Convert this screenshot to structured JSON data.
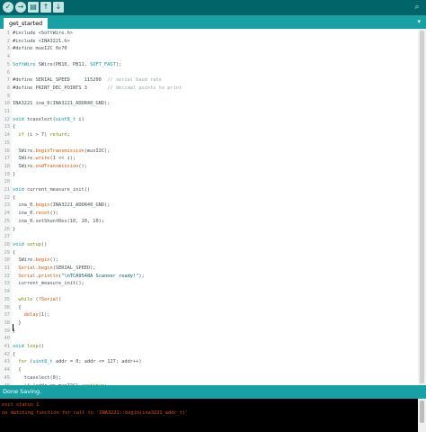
{
  "toolbar": {
    "verify_icon": "✓",
    "upload_icon": "→",
    "new_icon": "▤",
    "open_icon": "↑",
    "save_icon": "↓",
    "serial_monitor_icon": "⌕"
  },
  "tabs": [
    {
      "label": "get_started"
    }
  ],
  "tab_menu_icon": "▾",
  "editor": {
    "lines": [
      {
        "n": "1",
        "tokens": [
          {
            "t": "#include <SoftWire.h>"
          }
        ]
      },
      {
        "n": "2",
        "tokens": [
          {
            "t": "#include <INA3221.h>"
          }
        ]
      },
      {
        "n": "3",
        "tokens": [
          {
            "t": "#define muxI2C 0x70"
          }
        ]
      },
      {
        "n": "4",
        "tokens": []
      },
      {
        "n": "5",
        "tokens": [
          {
            "t": "SoftWire",
            "c": "ty"
          },
          {
            "t": " SWire(PB10, PB11, "
          },
          {
            "t": "SOFT_FAST",
            "c": "ty"
          },
          {
            "t": ");"
          }
        ]
      },
      {
        "n": "6",
        "tokens": []
      },
      {
        "n": "7",
        "tokens": [
          {
            "t": "#define SERIAL_SPEED     115200  "
          },
          {
            "t": "// serial baud rate",
            "c": "cm"
          }
        ]
      },
      {
        "n": "8",
        "tokens": [
          {
            "t": "#define PRINT_DEC_POINTS 3       "
          },
          {
            "t": "// decimal points to print",
            "c": "cm"
          }
        ]
      },
      {
        "n": "9",
        "tokens": []
      },
      {
        "n": "10",
        "tokens": [
          {
            "t": "INA3221 ina_0(INA3221_ADDR40_GND);"
          }
        ]
      },
      {
        "n": "11",
        "tokens": []
      },
      {
        "n": "12",
        "tokens": [
          {
            "t": "void",
            "c": "ty"
          },
          {
            "t": " tcaselect("
          },
          {
            "t": "uint8_t",
            "c": "ty"
          },
          {
            "t": " i)"
          }
        ]
      },
      {
        "n": "13",
        "tokens": [
          {
            "t": "{"
          }
        ]
      },
      {
        "n": "14",
        "tokens": [
          {
            "t": "  "
          },
          {
            "t": "if",
            "c": "kw"
          },
          {
            "t": " (i > 7) "
          },
          {
            "t": "return",
            "c": "kw"
          },
          {
            "t": ";"
          }
        ]
      },
      {
        "n": "15",
        "tokens": []
      },
      {
        "n": "16",
        "tokens": [
          {
            "t": "  SWire."
          },
          {
            "t": "beginTransmission",
            "c": "fn"
          },
          {
            "t": "(muxI2C);"
          }
        ]
      },
      {
        "n": "17",
        "tokens": [
          {
            "t": "  SWire."
          },
          {
            "t": "write",
            "c": "fn"
          },
          {
            "t": "(1 << i);"
          }
        ]
      },
      {
        "n": "18",
        "tokens": [
          {
            "t": "  SWire."
          },
          {
            "t": "endTransmission",
            "c": "fn"
          },
          {
            "t": "();"
          }
        ]
      },
      {
        "n": "19",
        "tokens": [
          {
            "t": "}"
          }
        ]
      },
      {
        "n": "20",
        "tokens": []
      },
      {
        "n": "21",
        "tokens": [
          {
            "t": "void",
            "c": "ty"
          },
          {
            "t": " current_measure_init()"
          }
        ]
      },
      {
        "n": "22",
        "tokens": [
          {
            "t": "{"
          }
        ]
      },
      {
        "n": "23",
        "tokens": [
          {
            "t": "  ina_0."
          },
          {
            "t": "begin",
            "c": "fn"
          },
          {
            "t": "(INA3221_ADDR40_GND);"
          }
        ]
      },
      {
        "n": "24",
        "tokens": [
          {
            "t": "  ina_0."
          },
          {
            "t": "reset",
            "c": "fn"
          },
          {
            "t": "();"
          }
        ]
      },
      {
        "n": "25",
        "tokens": [
          {
            "t": "  ina_0.setShuntRes(10, 10, 10);"
          }
        ]
      },
      {
        "n": "26",
        "tokens": [
          {
            "t": "}"
          }
        ]
      },
      {
        "n": "27",
        "tokens": []
      },
      {
        "n": "28",
        "tokens": [
          {
            "t": "void",
            "c": "ty"
          },
          {
            "t": " "
          },
          {
            "t": "setup",
            "c": "kw"
          },
          {
            "t": "()"
          }
        ]
      },
      {
        "n": "29",
        "tokens": [
          {
            "t": "{"
          }
        ]
      },
      {
        "n": "30",
        "tokens": [
          {
            "t": "  SWire."
          },
          {
            "t": "begin",
            "c": "fn"
          },
          {
            "t": "();"
          }
        ]
      },
      {
        "n": "31",
        "tokens": [
          {
            "t": "  "
          },
          {
            "t": "Serial",
            "c": "fn"
          },
          {
            "t": "."
          },
          {
            "t": "begin",
            "c": "fn"
          },
          {
            "t": "(SERIAL_SPEED);"
          }
        ]
      },
      {
        "n": "32",
        "tokens": [
          {
            "t": "  "
          },
          {
            "t": "Serial",
            "c": "fn"
          },
          {
            "t": "."
          },
          {
            "t": "println",
            "c": "fn"
          },
          {
            "t": "("
          },
          {
            "t": "\"\\nTCA9548A Scanner ready!\"",
            "c": "st"
          },
          {
            "t": ");"
          }
        ]
      },
      {
        "n": "33",
        "tokens": [
          {
            "t": "  current_measure_init();"
          }
        ]
      },
      {
        "n": "34",
        "tokens": []
      },
      {
        "n": "35",
        "tokens": [
          {
            "t": "  "
          },
          {
            "t": "while",
            "c": "kw"
          },
          {
            "t": " (!"
          },
          {
            "t": "Serial",
            "c": "fn"
          },
          {
            "t": ")"
          }
        ]
      },
      {
        "n": "36",
        "tokens": [
          {
            "t": "  {"
          }
        ]
      },
      {
        "n": "37",
        "tokens": [
          {
            "t": "    "
          },
          {
            "t": "delay",
            "c": "fn"
          },
          {
            "t": "(1);"
          }
        ]
      },
      {
        "n": "38",
        "tokens": [
          {
            "t": "  }"
          }
        ]
      },
      {
        "n": "39",
        "tokens": [
          {
            "t": "}"
          }
        ]
      },
      {
        "n": "40",
        "tokens": []
      },
      {
        "n": "41",
        "tokens": [
          {
            "t": "void",
            "c": "ty"
          },
          {
            "t": " "
          },
          {
            "t": "loop",
            "c": "kw"
          },
          {
            "t": "()"
          }
        ]
      },
      {
        "n": "42",
        "tokens": [
          {
            "t": "{"
          }
        ]
      },
      {
        "n": "43",
        "tokens": [
          {
            "t": "  "
          },
          {
            "t": "for",
            "c": "kw"
          },
          {
            "t": " ("
          },
          {
            "t": "uint8_t",
            "c": "ty"
          },
          {
            "t": " addr = 0; addr <= 127; addr++)"
          }
        ]
      },
      {
        "n": "44",
        "tokens": [
          {
            "t": "  {"
          }
        ]
      },
      {
        "n": "45",
        "tokens": [
          {
            "t": "    tcaselect(0);"
          }
        ]
      },
      {
        "n": "46",
        "tokens": [
          {
            "t": "    "
          },
          {
            "t": "if",
            "c": "kw"
          },
          {
            "t": " (addr == muxI2C) "
          },
          {
            "t": "continue",
            "c": "kw"
          },
          {
            "t": ";"
          }
        ]
      }
    ]
  },
  "status": {
    "message": "Done Saving."
  },
  "console": {
    "lines": [
      "exit status 1",
      "no matching function for call to 'INA3221::begin(ina3221_addr_t)'"
    ]
  },
  "colors": {
    "toolbar_bg": "#006468",
    "tabbar_bg": "#17a1a5",
    "keyword": "#728e00",
    "function": "#d35400",
    "type": "#00979c",
    "comment": "#95a5a6",
    "error_text": "#e34c00"
  }
}
